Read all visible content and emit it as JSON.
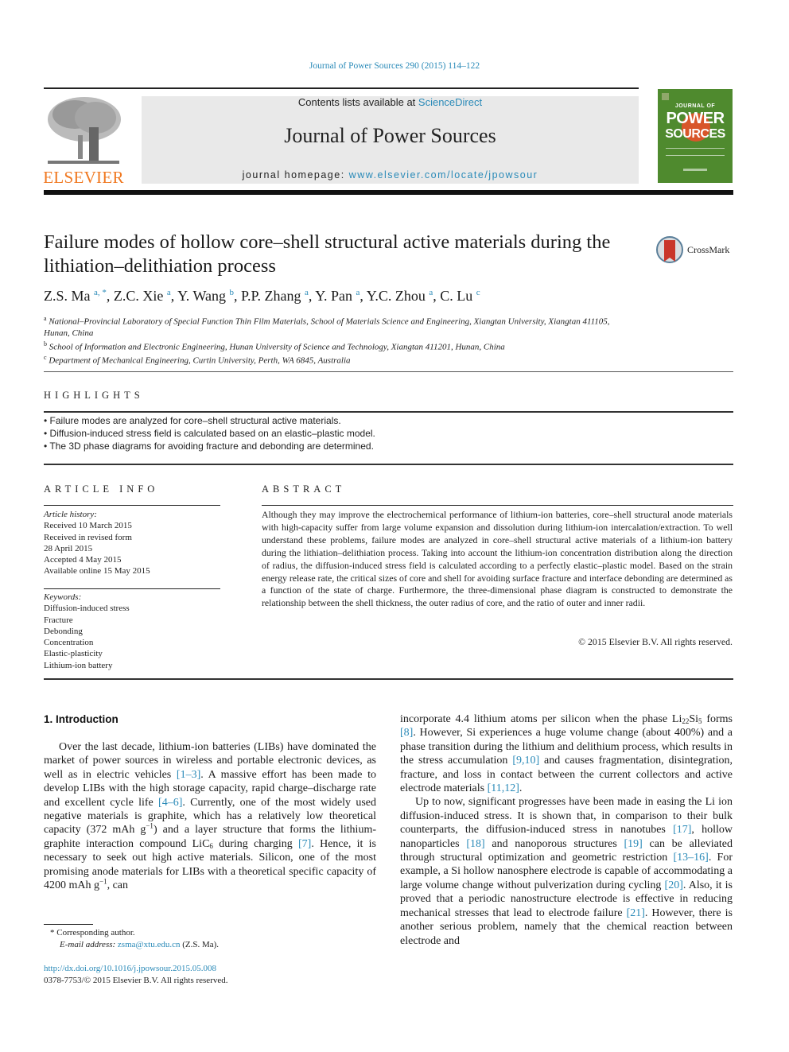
{
  "header": {
    "citation": "Journal of Power Sources 290 (2015) 114–122",
    "publisher_logo_text": "ELSEVIER",
    "contents_prefix": "Contents lists available at ",
    "contents_link": "ScienceDirect",
    "journal_title": "Journal of Power Sources",
    "homepage_prefix": "journal homepage: ",
    "homepage_link": "www.elsevier.com/locate/jpowsour",
    "cover": {
      "kicker": "JOURNAL OF",
      "word1": "POWER",
      "word2": "SOURCES",
      "color": "#4f8a2e"
    },
    "colors": {
      "link": "#2a8ab8",
      "elsevier_orange": "#f07820",
      "header_box": "#e9e9e9"
    }
  },
  "article": {
    "title": "Failure modes of hollow core–shell structural active materials during the lithiation–delithiation process",
    "crossmark_label": "CrossMark",
    "authors": [
      {
        "name": "Z.S. Ma",
        "sup": "a, *",
        "sep": ", "
      },
      {
        "name": "Z.C. Xie",
        "sup": "a",
        "sep": ", "
      },
      {
        "name": "Y. Wang",
        "sup": "b",
        "sep": ", "
      },
      {
        "name": "P.P. Zhang",
        "sup": "a",
        "sep": ", "
      },
      {
        "name": "Y. Pan",
        "sup": "a",
        "sep": ", "
      },
      {
        "name": "Y.C. Zhou",
        "sup": "a",
        "sep": ", "
      },
      {
        "name": "C. Lu",
        "sup": "c",
        "sep": ""
      }
    ],
    "affiliations": [
      {
        "key": "a",
        "text": "National–Provincial Laboratory of Special Function Thin Film Materials, School of Materials Science and Engineering, Xiangtan University, Xiangtan 411105, Hunan, China"
      },
      {
        "key": "b",
        "text": "School of Information and Electronic Engineering, Hunan University of Science and Technology, Xiangtan 411201, Hunan, China"
      },
      {
        "key": "c",
        "text": "Department of Mechanical Engineering, Curtin University, Perth, WA 6845, Australia"
      }
    ]
  },
  "highlights": {
    "label": "HIGHLIGHTS",
    "items": [
      "• Failure modes are analyzed for core–shell structural active materials.",
      "• Diffusion-induced stress field is calculated based on an elastic–plastic model.",
      "• The 3D phase diagrams for avoiding fracture and debonding are determined."
    ]
  },
  "article_info": {
    "label": "ARTICLE INFO",
    "history_label": "Article history:",
    "history": [
      "Received 10 March 2015",
      "Received in revised form",
      "28 April 2015",
      "Accepted 4 May 2015",
      "Available online 15 May 2015"
    ],
    "keywords_label": "Keywords:",
    "keywords": [
      "Diffusion-induced stress",
      "Fracture",
      "Debonding",
      "Concentration",
      "Elastic-plasticity",
      "Lithium-ion battery"
    ]
  },
  "abstract": {
    "label": "ABSTRACT",
    "text": "Although they may improve the electrochemical performance of lithium-ion batteries, core–shell structural anode materials with high-capacity suffer from large volume expansion and dissolution during lithium-ion intercalation/extraction. To well understand these problems, failure modes are analyzed in core–shell structural active materials of a lithium-ion battery during the lithiation–delithiation process. Taking into account the lithium-ion concentration distribution along the direction of radius, the diffusion-induced stress field is calculated according to a perfectly elastic–plastic model. Based on the strain energy release rate, the critical sizes of core and shell for avoiding surface fracture and interface debonding are determined as a function of the state of charge. Furthermore, the three-dimensional phase diagram is constructed to demonstrate the relationship between the shell thickness, the outer radius of core, and the ratio of outer and inner radii.",
    "copyright": "© 2015 Elsevier B.V. All rights reserved."
  },
  "body": {
    "section_heading": "1.  Introduction",
    "left_paragraphs": [
      [
        {
          "t": "Over the last decade, lithium-ion batteries (LIBs) have dominated the market of power sources in wireless and portable electronic devices, as well as in electric vehicles "
        },
        {
          "ref": "[1–3]"
        },
        {
          "t": ". A massive effort has been made to develop LIBs with the high storage capacity, rapid charge–discharge rate and excellent cycle life "
        },
        {
          "ref": "[4–6]"
        },
        {
          "t": ". Currently, one of the most widely used negative materials is graphite, which has a relatively low theoretical capacity (372 mAh g"
        },
        {
          "sup": "−1"
        },
        {
          "t": ") and a layer structure that forms the lithium-graphite interaction compound LiC"
        },
        {
          "sub": "6"
        },
        {
          "t": " during charging "
        },
        {
          "ref": "[7]"
        },
        {
          "t": ". Hence, it is necessary to seek out high active materials. Silicon, one of the most promising anode materials for LIBs with a theoretical specific capacity of 4200 mAh g"
        },
        {
          "sup": "−1"
        },
        {
          "t": ", can"
        }
      ]
    ],
    "right_paragraphs": [
      [
        {
          "t": "incorporate 4.4 lithium atoms per silicon when the phase Li"
        },
        {
          "sub": "22"
        },
        {
          "t": "Si"
        },
        {
          "sub": "5"
        },
        {
          "t": " forms "
        },
        {
          "ref": "[8]"
        },
        {
          "t": ". However, Si experiences a huge volume change (about 400%) and a phase transition during the lithium and delithium process, which results in the stress accumulation "
        },
        {
          "ref": "[9,10]"
        },
        {
          "t": " and causes fragmentation, disintegration, fracture, and loss in contact between the current collectors and active electrode materials "
        },
        {
          "ref": "[11,12]"
        },
        {
          "t": "."
        }
      ],
      [
        {
          "t": "Up to now, significant progresses have been made in easing the Li ion diffusion-induced stress. It is shown that, in comparison to their bulk counterparts, the diffusion-induced stress in nanotubes "
        },
        {
          "ref": "[17]"
        },
        {
          "t": ", hollow nanoparticles "
        },
        {
          "ref": "[18]"
        },
        {
          "t": " and nanoporous structures "
        },
        {
          "ref": "[19]"
        },
        {
          "t": " can be alleviated through structural optimization and geometric restriction "
        },
        {
          "ref": "[13–16]"
        },
        {
          "t": ". For example, a Si hollow nanosphere electrode is capable of accommodating a large volume change without pulverization during cycling "
        },
        {
          "ref": "[20]"
        },
        {
          "t": ". Also, it is proved that a periodic nanostructure electrode is effective in reducing mechanical stresses that lead to electrode failure "
        },
        {
          "ref": "[21]"
        },
        {
          "t": ". However, there is another serious problem, namely that the chemical reaction between electrode and"
        }
      ]
    ]
  },
  "footnotes": {
    "corresponding": "* Corresponding author.",
    "email_label": "E-mail address: ",
    "email": "zsma@xtu.edu.cn",
    "email_suffix": " (Z.S. Ma).",
    "doi": "http://dx.doi.org/10.1016/j.jpowsour.2015.05.008",
    "issn_copyright": "0378-7753/© 2015 Elsevier B.V. All rights reserved."
  }
}
